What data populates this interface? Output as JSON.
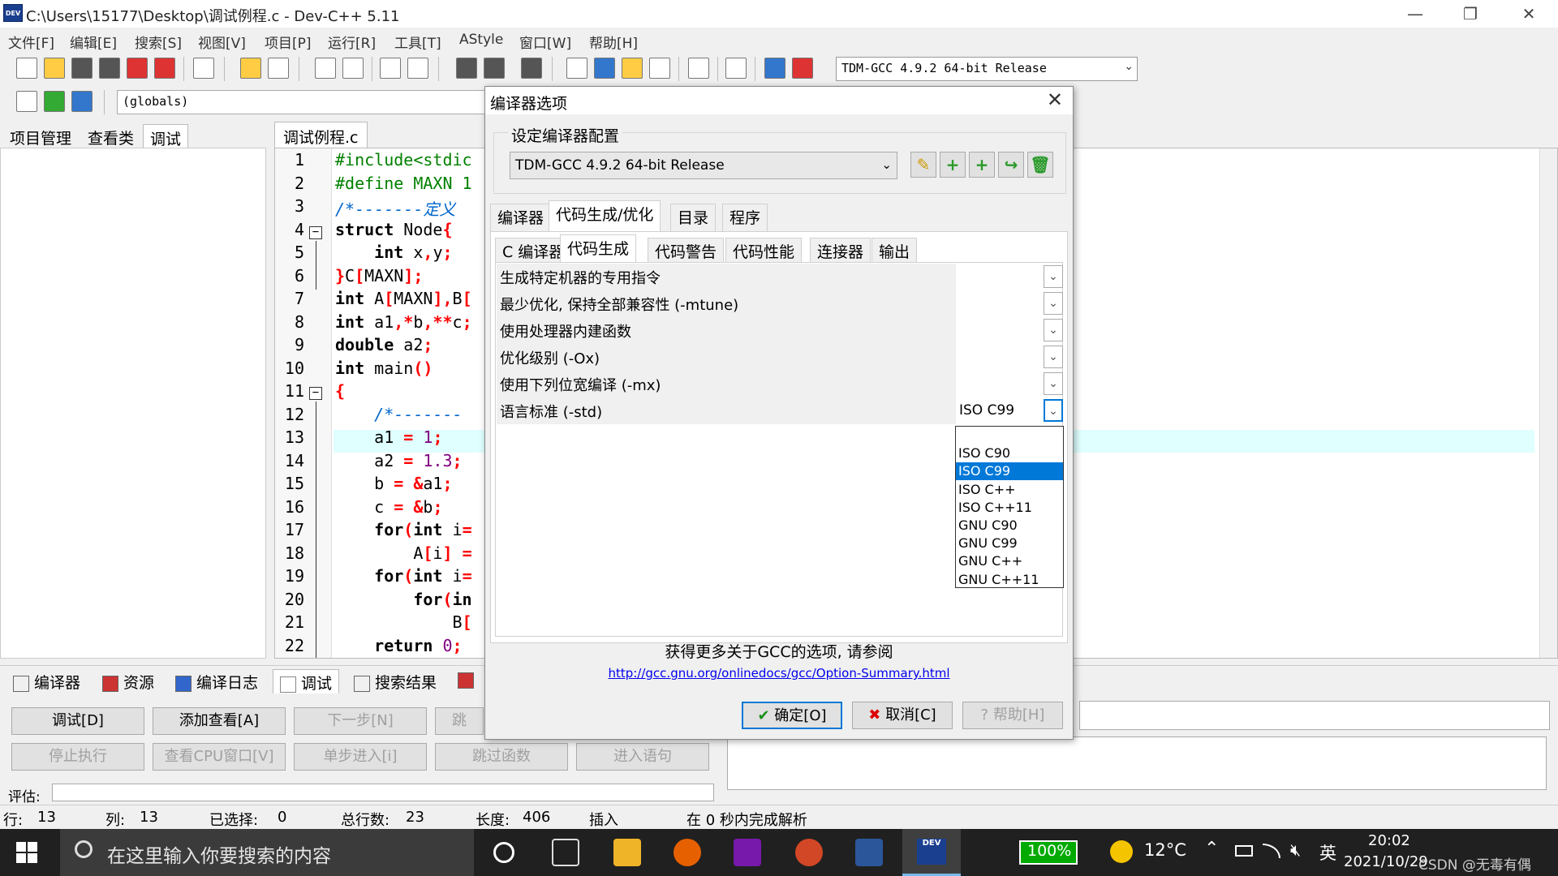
{
  "window": {
    "title": "C:\\Users\\15177\\Desktop\\调试例程.c - Dev-C++ 5.11",
    "app_icon_text": "DEV",
    "minimize": "—",
    "restore": "❐",
    "close": "✕"
  },
  "menu": [
    "文件[F]",
    "编辑[E]",
    "搜索[S]",
    "视图[V]",
    "项目[P]",
    "运行[R]",
    "工具[T]",
    "AStyle",
    "窗口[W]",
    "帮助[H]"
  ],
  "toolbar": {
    "compiler_select": "TDM-GCC 4.9.2 64-bit Release",
    "scope_select": "(globals)"
  },
  "left_tabs": [
    "项目管理",
    "查看类",
    "调试"
  ],
  "editor": {
    "tab_label": "调试例程.c",
    "lines": [
      {
        "n": "1",
        "html": "<span class='pp'>#include&lt;stdic</span>"
      },
      {
        "n": "2",
        "html": "<span class='pp'>#define MAXN 1</span>"
      },
      {
        "n": "3",
        "html": "<span class='cm'>/*-------定义</span>"
      },
      {
        "n": "4",
        "html": "<span class='kw'>struct</span> Node<span class='op'>{</span>"
      },
      {
        "n": "5",
        "html": "    <span class='kw'>int</span> x<span class='op'>,</span>y<span class='op'>;</span>"
      },
      {
        "n": "6",
        "html": "<span class='op'>}</span>C<span class='op'>[</span>MAXN<span class='op'>];</span>"
      },
      {
        "n": "7",
        "html": "<span class='kw'>int</span> A<span class='op'>[</span>MAXN<span class='op'>],</span>B<span class='op'>[</span>"
      },
      {
        "n": "8",
        "html": "<span class='kw'>int</span> a1<span class='op'>,*</span>b<span class='op'>,**</span>c<span class='op'>;</span>"
      },
      {
        "n": "9",
        "html": "<span class='kw'>double</span> a2<span class='op'>;</span>"
      },
      {
        "n": "10",
        "html": "<span class='kw'>int</span> main<span class='op'>()</span>"
      },
      {
        "n": "11",
        "html": "<span class='op'>{</span>"
      },
      {
        "n": "12",
        "html": "    <span class='cm'>/*-------</span>"
      },
      {
        "n": "13",
        "html": "    a1 <span class='op'>=</span> <span class='num'>1</span><span class='op'>;</span>"
      },
      {
        "n": "14",
        "html": "    a2 <span class='op'>=</span> <span class='num'>1.3</span><span class='op'>;</span>"
      },
      {
        "n": "15",
        "html": "    b <span class='op'>=</span> <span class='op'>&amp;</span>a1<span class='op'>;</span>"
      },
      {
        "n": "16",
        "html": "    c <span class='op'>=</span> <span class='op'>&amp;</span>b<span class='op'>;</span>"
      },
      {
        "n": "17",
        "html": "    <span class='kw'>for</span><span class='op'>(</span><span class='kw'>int</span> i<span class='op'>=</span>"
      },
      {
        "n": "18",
        "html": "        A<span class='op'>[</span>i<span class='op'>]</span> <span class='op'>=</span>"
      },
      {
        "n": "19",
        "html": "    <span class='kw'>for</span><span class='op'>(</span><span class='kw'>int</span> i<span class='op'>=</span>"
      },
      {
        "n": "20",
        "html": "        <span class='kw'>for</span><span class='op'>(</span><span class='kw'>in</span>"
      },
      {
        "n": "21",
        "html": "            B<span class='op'>[</span>"
      },
      {
        "n": "22",
        "html": "    <span class='kw'>return</span> <span class='num'>0</span><span class='op'>;</span>"
      }
    ]
  },
  "bottom_tabs": [
    "编译器",
    "资源",
    "编译日志",
    "调试",
    "搜索结果"
  ],
  "debug_buttons": {
    "debug": "调试[D]",
    "add_watch": "添加查看[A]",
    "next_step": "下一步[N]",
    "skip": "跳",
    "stop": "停止执行",
    "cpu_window": "查看CPU窗口[V]",
    "step_into": "单步进入[i]",
    "skip_function": "跳过函数",
    "into_statement": "进入语句"
  },
  "eval_label": "评估:",
  "status": {
    "row_label": "行:",
    "row": "13",
    "col_label": "列:",
    "col": "13",
    "sel_label": "已选择:",
    "sel": "0",
    "total_label": "总行数:",
    "total": "23",
    "len_label": "长度:",
    "len": "406",
    "mode": "插入",
    "parse": "在 0 秒内完成解析"
  },
  "dialog": {
    "title": "编译器选项",
    "group_label": "设定编译器配置",
    "config": "TDM-GCC 4.9.2 64-bit Release",
    "main_tabs": [
      "编译器",
      "代码生成/优化",
      "目录",
      "程序"
    ],
    "sub_tabs": [
      "C 编译器",
      "代码生成",
      "代码警告",
      "代码性能",
      "连接器",
      "输出"
    ],
    "options": [
      {
        "label": "生成特定机器的专用指令",
        "value": ""
      },
      {
        "label": "最少优化, 保持全部兼容性 (-mtune)",
        "value": ""
      },
      {
        "label": "使用处理器内建函数",
        "value": ""
      },
      {
        "label": "优化级别 (-Ox)",
        "value": ""
      },
      {
        "label": "使用下列位宽编译 (-mx)",
        "value": ""
      },
      {
        "label": "语言标准 (-std)",
        "value": "ISO C99"
      }
    ],
    "dropdown_items": [
      "",
      "ISO C90",
      "ISO C99",
      "ISO C++",
      "ISO C++11",
      "GNU C90",
      "GNU C99",
      "GNU C++",
      "GNU C++11"
    ],
    "dropdown_selected": 2,
    "info_text": "获得更多关于GCC的选项, 请参阅",
    "info_link": "http://gcc.gnu.org/onlinedocs/gcc/Option-Summary.html",
    "ok": "确定[O]",
    "cancel": "取消[C]",
    "help": "帮助[H]"
  },
  "taskbar": {
    "search_placeholder": "在这里输入你要搜索的内容",
    "battery": "100%",
    "weather": "12°C",
    "ime": "英",
    "time": "20:02",
    "date": "2021/10/29",
    "watermark": "CSDN @无毒有偶"
  }
}
